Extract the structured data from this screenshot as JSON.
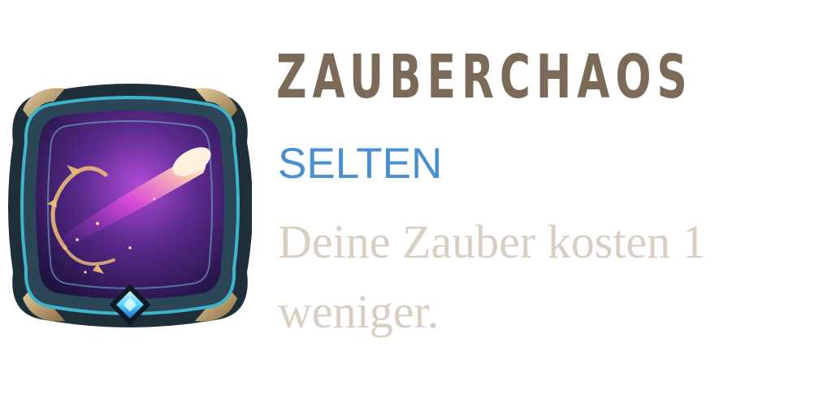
{
  "card": {
    "title": "ZAUBERCHAOS",
    "rarity": "SELTEN",
    "description": "Deine Zauber kosten 1 weniger."
  },
  "icon": {
    "name": "spell-chaos-comet-icon",
    "gem": "diamond-gem-icon"
  },
  "colors": {
    "title": "#7a6a57",
    "rarity": "#4a8fd0",
    "description": "#d8cfc2",
    "frame_dark": "#1f2f3a",
    "frame_teal": "#3fb3c9",
    "frame_gold": "#b99a6e",
    "art_purple": "#5a2a8c",
    "gem_blue": "#4fd2ff"
  }
}
